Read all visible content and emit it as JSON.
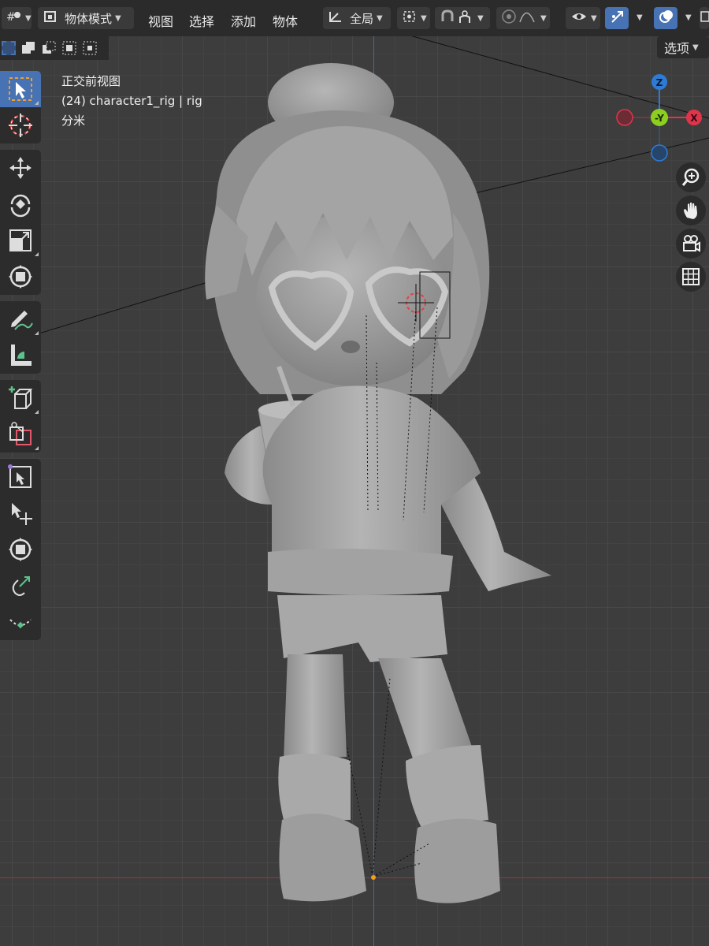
{
  "header": {
    "mode_label": "物体模式",
    "menus": [
      "视图",
      "选择",
      "添加",
      "物体"
    ],
    "orientation_label": "全局"
  },
  "options_label": "选项",
  "viewport_info": {
    "view_name": "正交前视图",
    "object_info": "(24) character1_rig | rig",
    "units": "分米"
  },
  "gizmo": {
    "axis_z": "Z",
    "axis_y": "-Y",
    "axis_x": "X",
    "colors": {
      "x": "#e0344c",
      "y": "#8ccf1f",
      "z": "#2e7bd6"
    }
  },
  "toolbar": {
    "groups": [
      [
        "select-box-tool",
        "cursor-tool"
      ],
      [
        "move-tool",
        "rotate-tool",
        "scale-tool",
        "transform-tool"
      ],
      [
        "annotate-tool",
        "measure-tool"
      ],
      [
        "add-cube-tool",
        "duplicate-tool"
      ],
      [
        "transform-pivot-tool",
        "move-select-tool",
        "bone-tool",
        "bend-tool",
        "curve-tool"
      ]
    ]
  },
  "nav_buttons": [
    "zoom-icon",
    "hand-pan-icon",
    "camera-icon",
    "grid-icon"
  ],
  "accent_color": "#4772b3"
}
